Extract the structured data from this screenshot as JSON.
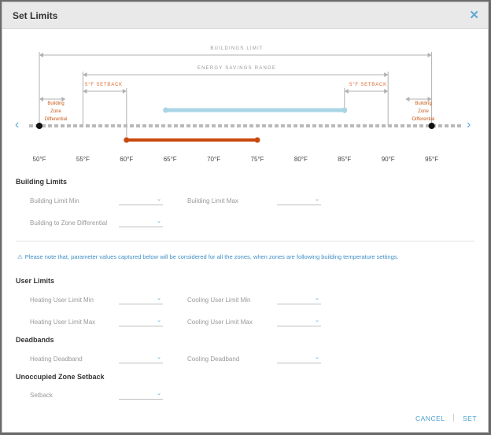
{
  "dialog": {
    "title": "Set Limits",
    "close_glyph": "✕"
  },
  "diagram": {
    "buildings_limit_label": "BUILDINGS LIMIT",
    "energy_savings_label": "ENERGY SAVINGS RANGE",
    "setback_left_label": "5°F SETBACK",
    "setback_right_label": "5°F SETBACK",
    "zone_diff_left": [
      "Building",
      "Zone",
      "Differential"
    ],
    "zone_diff_right": [
      "Building",
      "Zone",
      "Differential"
    ],
    "ticks": [
      "50°F",
      "55°F",
      "60°F",
      "65°F",
      "70°F",
      "75°F",
      "80°F",
      "85°F",
      "90°F",
      "95°F"
    ],
    "building_limit_range_f": [
      50,
      95
    ],
    "energy_savings_range_f": [
      55,
      90
    ],
    "setback_f": 5,
    "zone_differential_f": 3,
    "cooling_range_f": [
      64.5,
      85
    ],
    "heating_range_f": [
      60,
      75
    ],
    "colors": {
      "cooling": "#a9d6e5",
      "heating": "#c8490c",
      "line": "#b0b0b0",
      "accent": "#5fa8d3"
    },
    "prev_icon": "‹",
    "next_icon": "›"
  },
  "building_limits": {
    "heading": "Building Limits",
    "min_label": "Building Limit Min",
    "max_label": "Building Limit Max",
    "zone_diff_label": "Building to Zone Differential"
  },
  "note": {
    "icon": "⚠",
    "text": "Please note that, parameter values captured below will be considered for all the zones, when zones are following building temperature settings."
  },
  "user_limits": {
    "heading": "User Limits",
    "heating_min": "Heating User Limit Min",
    "cooling_min": "Cooling User Limit Min",
    "heating_max": "Heating User Limit Max",
    "cooling_max": "Cooling User Limit Max"
  },
  "deadbands": {
    "heading": "Deadbands",
    "heating": "Heating Deadband",
    "cooling": "Cooling Deadband"
  },
  "setback": {
    "heading": "Unoccupied Zone Setback",
    "label": "Setback"
  },
  "dropdown_caret": "⌄",
  "footer": {
    "cancel": "CANCEL",
    "set": "SET"
  }
}
